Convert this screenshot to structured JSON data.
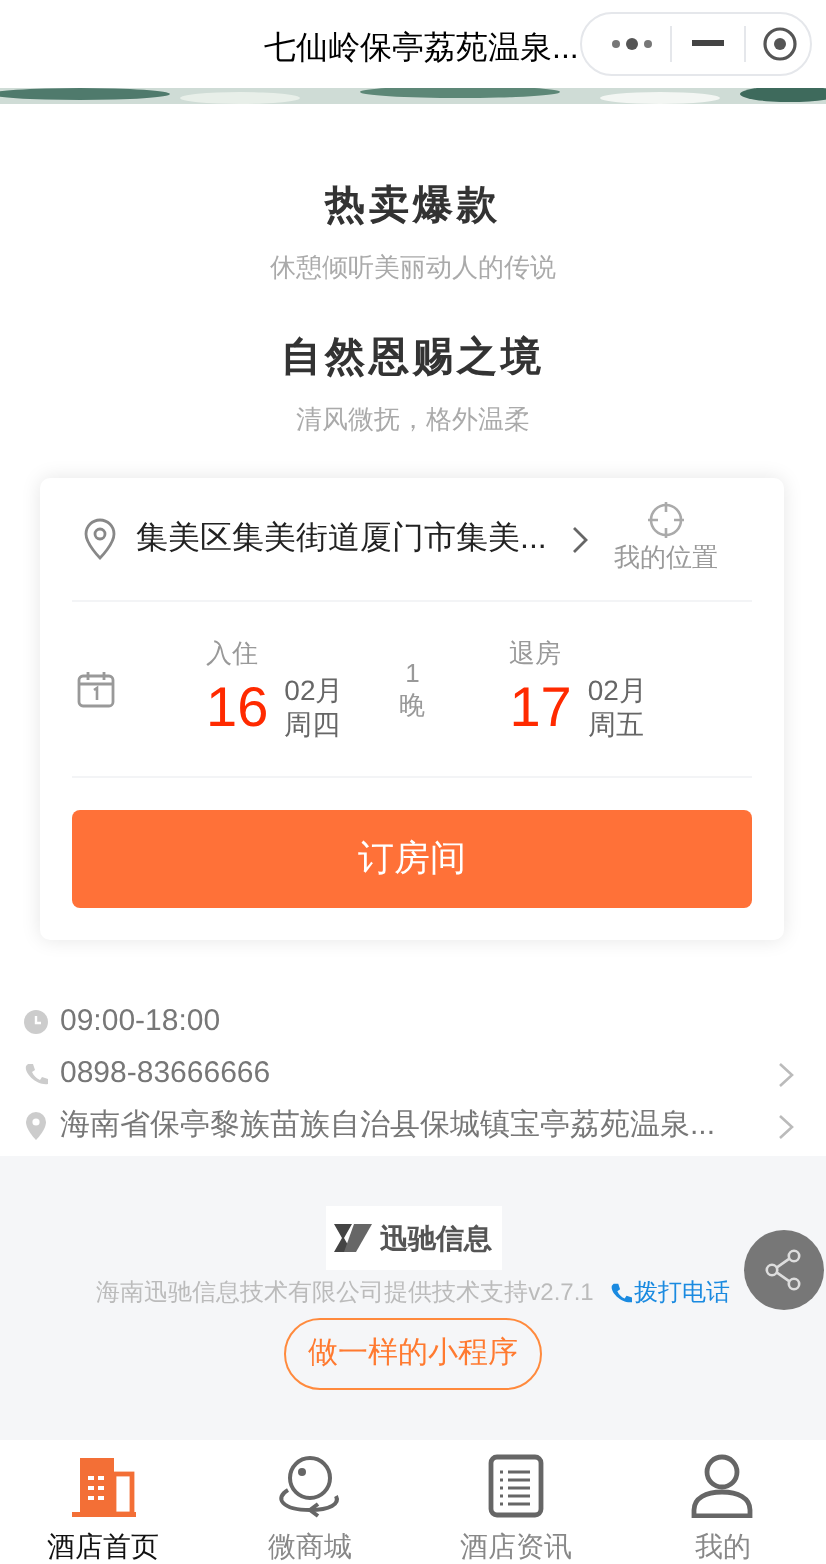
{
  "header": {
    "title": "七仙岭保亭荔苑温泉..."
  },
  "sections": [
    {
      "title": "热卖爆款",
      "subtitle": "休憩倾听美丽动人的传说"
    },
    {
      "title": "自然恩赐之境",
      "subtitle": "清风微抚，格外温柔"
    }
  ],
  "booking": {
    "location": "集美区集美街道厦门市集美...",
    "my_location": "我的位置",
    "check_in": {
      "label": "入住",
      "day": "16",
      "month": "02月",
      "weekday": "周四"
    },
    "nights": {
      "count": "1",
      "unit": "晚"
    },
    "check_out": {
      "label": "退房",
      "day": "17",
      "month": "02月",
      "weekday": "周五"
    },
    "button": "订房间"
  },
  "info": [
    {
      "kind": "hours",
      "text": "09:00-18:00",
      "arrow": false
    },
    {
      "kind": "phone",
      "text": "0898-83666666",
      "arrow": true
    },
    {
      "kind": "address",
      "text": "海南省保亭黎族苗族自治县保城镇宝亭荔苑温泉...",
      "arrow": true
    }
  ],
  "footer": {
    "logo": "迅驰信息",
    "credit": "海南迅驰信息技术有限公司提供技术支持v2.7.1",
    "call": "拨打电话",
    "button": "做一样的小程序"
  },
  "tabs": [
    {
      "kind": "hotel",
      "label": "酒店首页",
      "selected": true
    },
    {
      "kind": "shop",
      "label": "微商城",
      "selected": false
    },
    {
      "kind": "news",
      "label": "酒店资讯",
      "selected": false
    },
    {
      "kind": "me",
      "label": "我的",
      "selected": false
    }
  ]
}
